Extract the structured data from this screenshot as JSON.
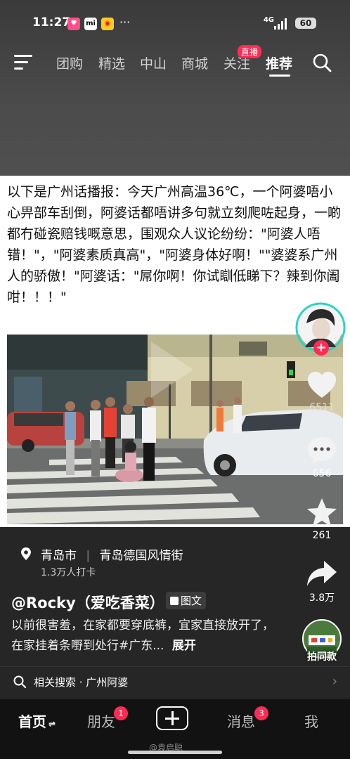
{
  "status": {
    "time": "11:27",
    "network": "4G",
    "battery": "60"
  },
  "nav": {
    "tabs": [
      {
        "label": "团购"
      },
      {
        "label": "精选"
      },
      {
        "label": "中山"
      },
      {
        "label": "商城"
      },
      {
        "label": "关注",
        "badge": "直播"
      },
      {
        "label": "推荐",
        "active": true
      }
    ]
  },
  "post": {
    "text": "以下是广州话播报：今天广州高温36℃，一个阿婆唔小心畀部车刮倒，阿婆话都唔讲多句就立刻爬咗起身，一啲都冇碰瓷赔钱嘅意思，围观众人议论纷纷：\"阿婆人唔错！\"，\"阿婆素质真高\"，\"阿婆身体好啊！\"\"婆婆系广州人的骄傲！\"阿婆话：\"屌你啊！你试瞓低睇下？辣到你阖咁！！！\""
  },
  "side": {
    "likes": "6511",
    "comments": "656",
    "favorites": "261",
    "shares": "3.8万",
    "same": "拍同款"
  },
  "location": {
    "city": "青岛市",
    "place": "青岛德国风情街",
    "checkins": "1.3万人打卡"
  },
  "author": {
    "name": "@Rocky（爱吃香菜）",
    "tag": "图文"
  },
  "description": {
    "text": "以前很害羞，在家都要穿底裤，宜家直接放开了，在家挂着条嘢到处行#广东...",
    "expand": "展开"
  },
  "related": {
    "label": "相关搜索 · 广州阿婆"
  },
  "tabbar": {
    "home": "首页",
    "friends": "朋友",
    "friends_badge": "1",
    "messages": "消息",
    "messages_badge": "3",
    "me": "我"
  },
  "watermark": "@袁启聪"
}
